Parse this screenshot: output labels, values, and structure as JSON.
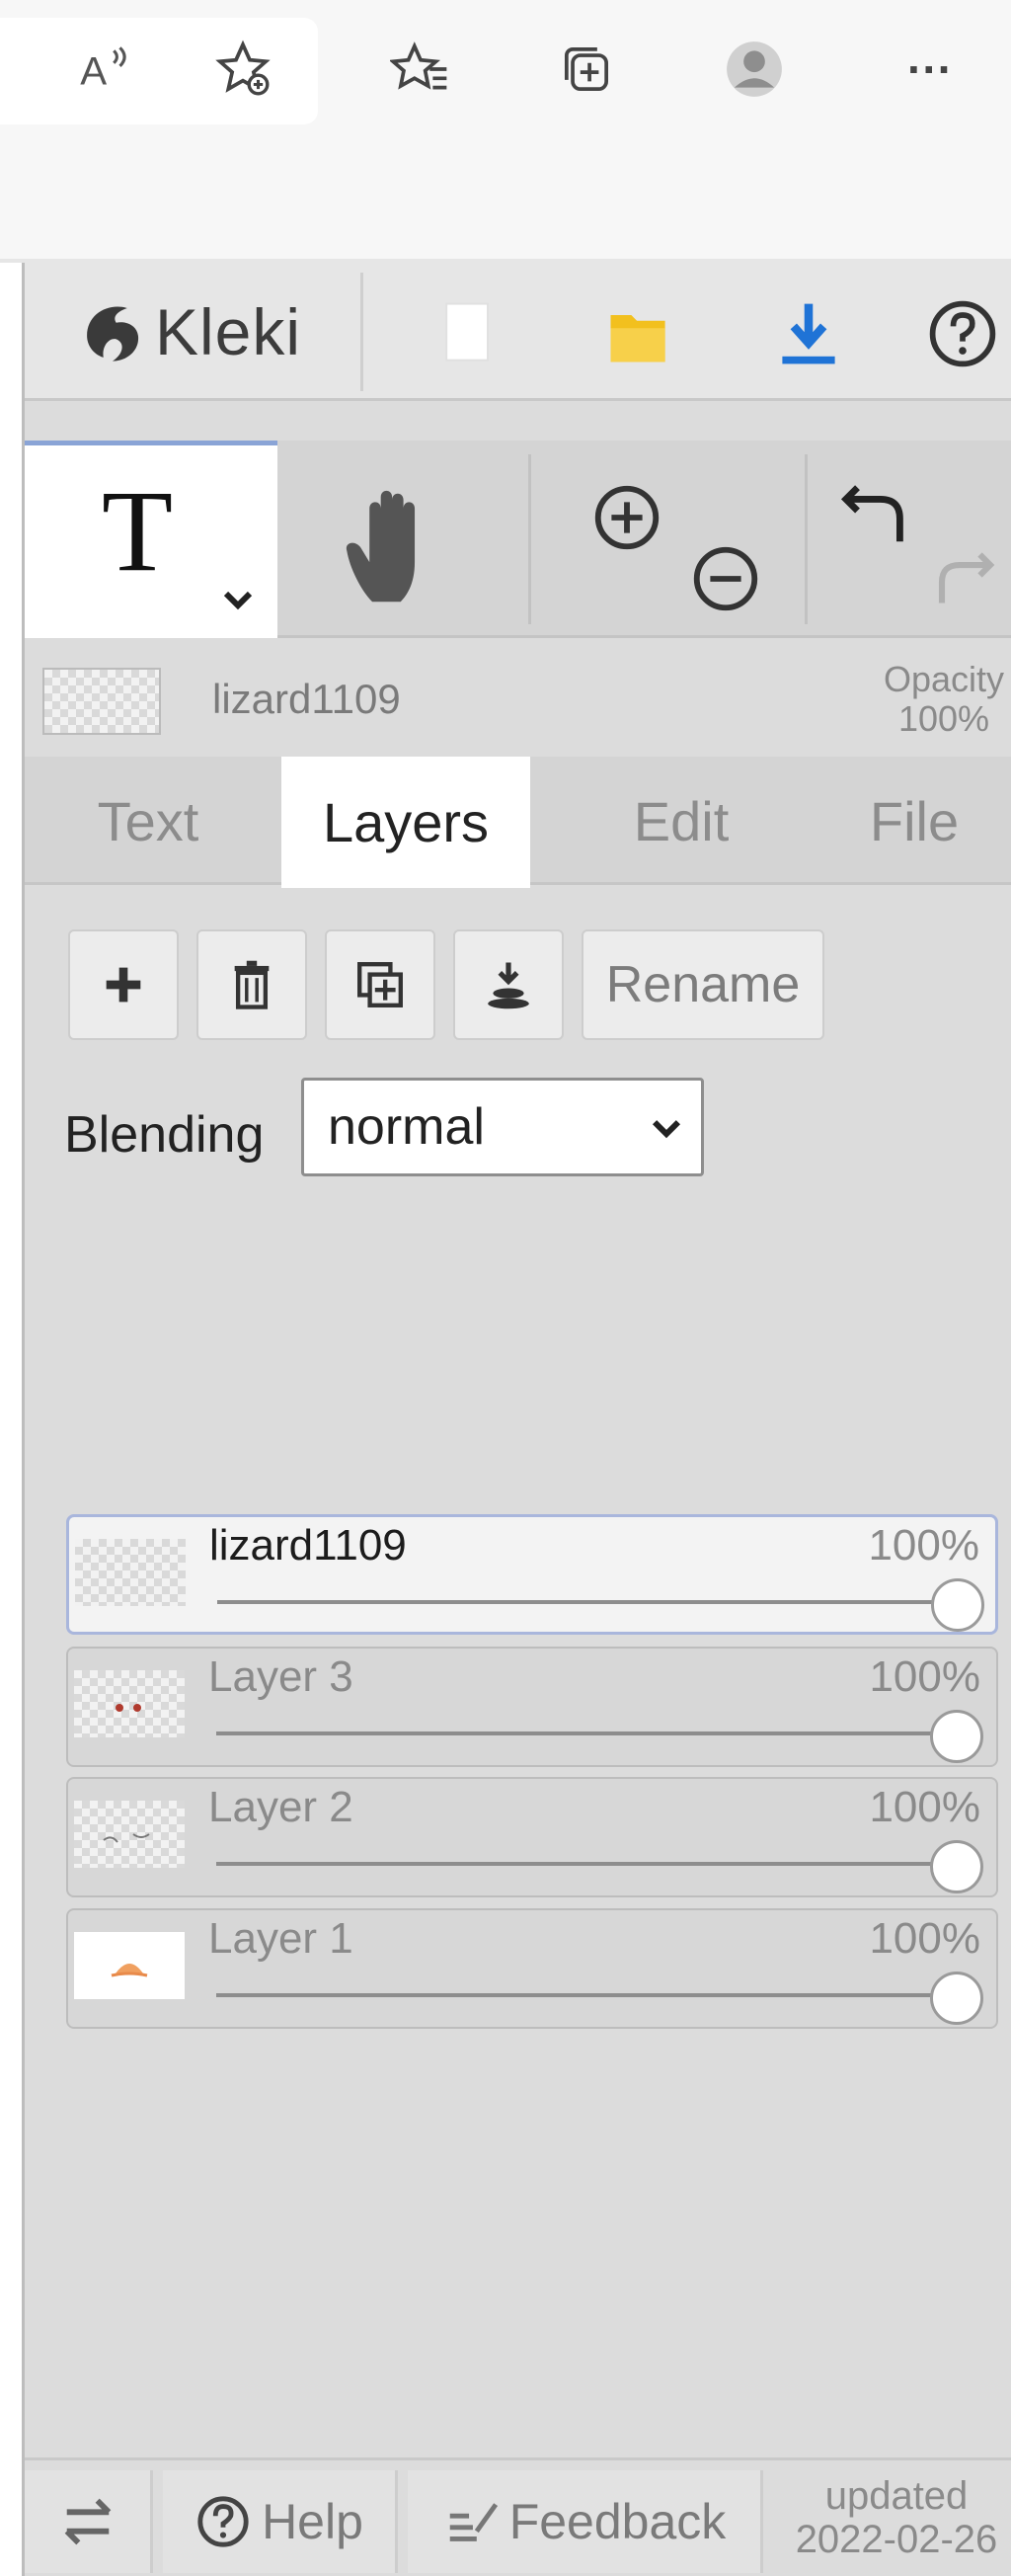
{
  "browser": {
    "icons": [
      "read-aloud-icon",
      "add-favorite-icon",
      "favorites-icon",
      "collections-icon",
      "profile-icon",
      "more-icon"
    ],
    "more_label": "···",
    "read_aloud_label": "A"
  },
  "app": {
    "name": "Kleki",
    "header_buttons": [
      "new-image-icon",
      "open-image-icon",
      "save-image-icon",
      "help-icon"
    ]
  },
  "tools": {
    "active_tool_label": "T",
    "icons": [
      "text-tool-icon",
      "hand-tool-icon",
      "zoom-in-icon",
      "zoom-out-icon",
      "undo-icon",
      "redo-icon"
    ]
  },
  "layer_info": {
    "name": "lizard1109",
    "opacity_label": "Opacity",
    "opacity_value": "100%"
  },
  "tabs": [
    {
      "label": "Text",
      "active": false
    },
    {
      "label": "Layers",
      "active": true
    },
    {
      "label": "Edit",
      "active": false
    },
    {
      "label": "File",
      "active": false
    }
  ],
  "layer_tools": {
    "buttons": [
      "add-layer-icon",
      "delete-layer-icon",
      "duplicate-layer-icon",
      "merge-down-icon"
    ],
    "rename_label": "Rename"
  },
  "blending": {
    "label": "Blending",
    "value": "normal"
  },
  "layers": [
    {
      "name": "lizard1109",
      "opacity": "100%",
      "opacity_fraction": 1.0,
      "selected": true
    },
    {
      "name": "Layer 3",
      "opacity": "100%",
      "opacity_fraction": 1.0,
      "selected": false
    },
    {
      "name": "Layer 2",
      "opacity": "100%",
      "opacity_fraction": 1.0,
      "selected": false
    },
    {
      "name": "Layer 1",
      "opacity": "100%",
      "opacity_fraction": 1.0,
      "selected": false
    }
  ],
  "footer": {
    "help_label": "Help",
    "feedback_label": "Feedback",
    "updated_label": "updated",
    "updated_date": "2022-02-26"
  },
  "colors": {
    "accent_blue": "#1f73d6",
    "folder_yellow": "#f2c01e",
    "selected_border": "#a9b6dc"
  }
}
